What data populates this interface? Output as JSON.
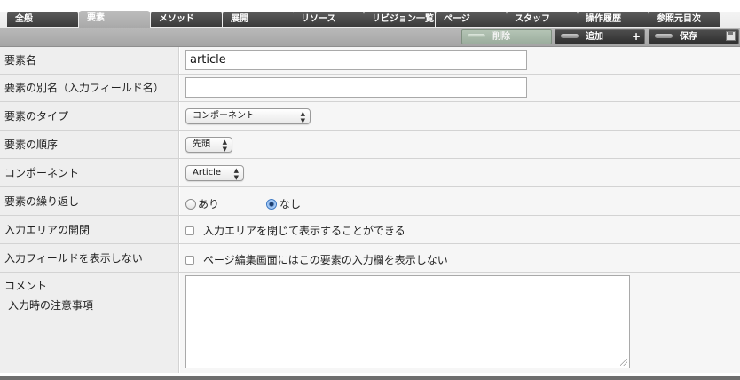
{
  "tabs": [
    {
      "label": "全般",
      "active": false
    },
    {
      "label": "要素",
      "active": true
    },
    {
      "label": "メソッド",
      "active": false
    },
    {
      "label": "展開",
      "active": false
    },
    {
      "label": "リソース",
      "active": false
    },
    {
      "label": "リビジョン一覧",
      "active": false
    },
    {
      "label": "ページ",
      "active": false
    },
    {
      "label": "スタッフ",
      "active": false
    },
    {
      "label": "操作履歴",
      "active": false
    },
    {
      "label": "参照元目次",
      "active": false
    }
  ],
  "toolbar": {
    "delete_label": "削除",
    "add_label": "追加",
    "add_suffix": "+",
    "save_label": "保存"
  },
  "form": {
    "element_name": {
      "label": "要素名",
      "value": "article"
    },
    "element_alias": {
      "label": "要素の別名（入力フィールド名）",
      "value": ""
    },
    "element_type": {
      "label": "要素のタイプ",
      "selected": "コンポーネント"
    },
    "element_order": {
      "label": "要素の順序",
      "selected": "先頭"
    },
    "component": {
      "label": "コンポーネント",
      "selected": "Article"
    },
    "repeat": {
      "label": "要素の繰り返し",
      "option_yes": "あり",
      "option_no": "なし",
      "selected": "なし"
    },
    "collapsible": {
      "label": "入力エリアの開閉",
      "checkbox_label": "入力エリアを閉じて表示することができる",
      "checked": false
    },
    "hide_field": {
      "label": "入力フィールドを表示しない",
      "checkbox_label": "ページ編集画面にはこの要素の入力欄を表示しない",
      "checked": false
    },
    "comment": {
      "label": "コメント",
      "sublabel": "入力時の注意事項",
      "value": ""
    }
  },
  "colors": {
    "tab_bg": "#3a3a3a",
    "tab_active_bg": "#b0b0b0",
    "label_bg": "#eeeeee",
    "value_bg": "#f6f6f6",
    "radio_checked": "#3b78c4"
  },
  "icons": {
    "save": "floppy-disk-icon",
    "select_arrows": "updown-arrows-icon",
    "resize": "resize-grip-icon"
  }
}
